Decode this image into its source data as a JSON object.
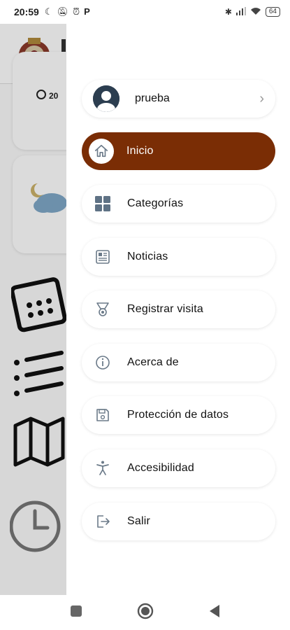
{
  "status_bar": {
    "time": "20:59",
    "battery": "64"
  },
  "background_app": {
    "card_time_partial": "20"
  },
  "drawer": {
    "profile": {
      "name": "prueba"
    },
    "items": [
      {
        "label": "Inicio",
        "icon": "home-icon",
        "active": true
      },
      {
        "label": "Categorías",
        "icon": "grid-icon"
      },
      {
        "label": "Noticias",
        "icon": "newspaper-icon"
      },
      {
        "label": "Registrar visita",
        "icon": "medal-icon"
      },
      {
        "label": "Acerca de",
        "icon": "info-icon"
      },
      {
        "label": "Protección de datos",
        "icon": "save-icon"
      },
      {
        "label": "Accesibilidad",
        "icon": "accessibility-icon"
      },
      {
        "label": "Salir",
        "icon": "logout-icon"
      }
    ]
  },
  "colors": {
    "active_item": "#7a2d05",
    "icon_gray": "#6b7a89"
  }
}
